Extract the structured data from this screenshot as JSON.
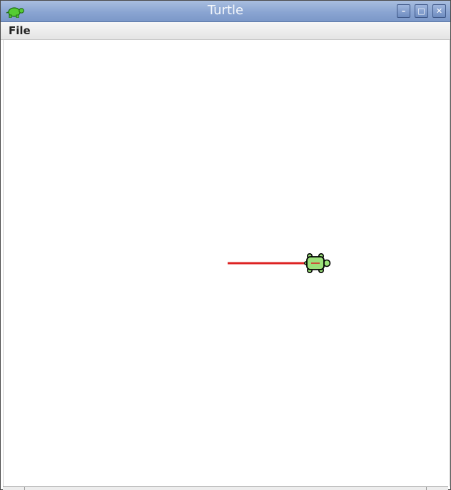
{
  "window": {
    "title": "Turtle"
  },
  "title_buttons": {
    "minimize_glyph": "–",
    "maximize_glyph": "□",
    "close_glyph": "✕"
  },
  "menubar": {
    "items": [
      {
        "label": "File"
      }
    ]
  },
  "canvas": {
    "pen_color": "#dd2222",
    "turtle_body_color": "#9be07a",
    "turtle_outline_color": "#000000",
    "turtle_heading": "east"
  },
  "icons": {
    "app_icon": "turtle-icon"
  }
}
